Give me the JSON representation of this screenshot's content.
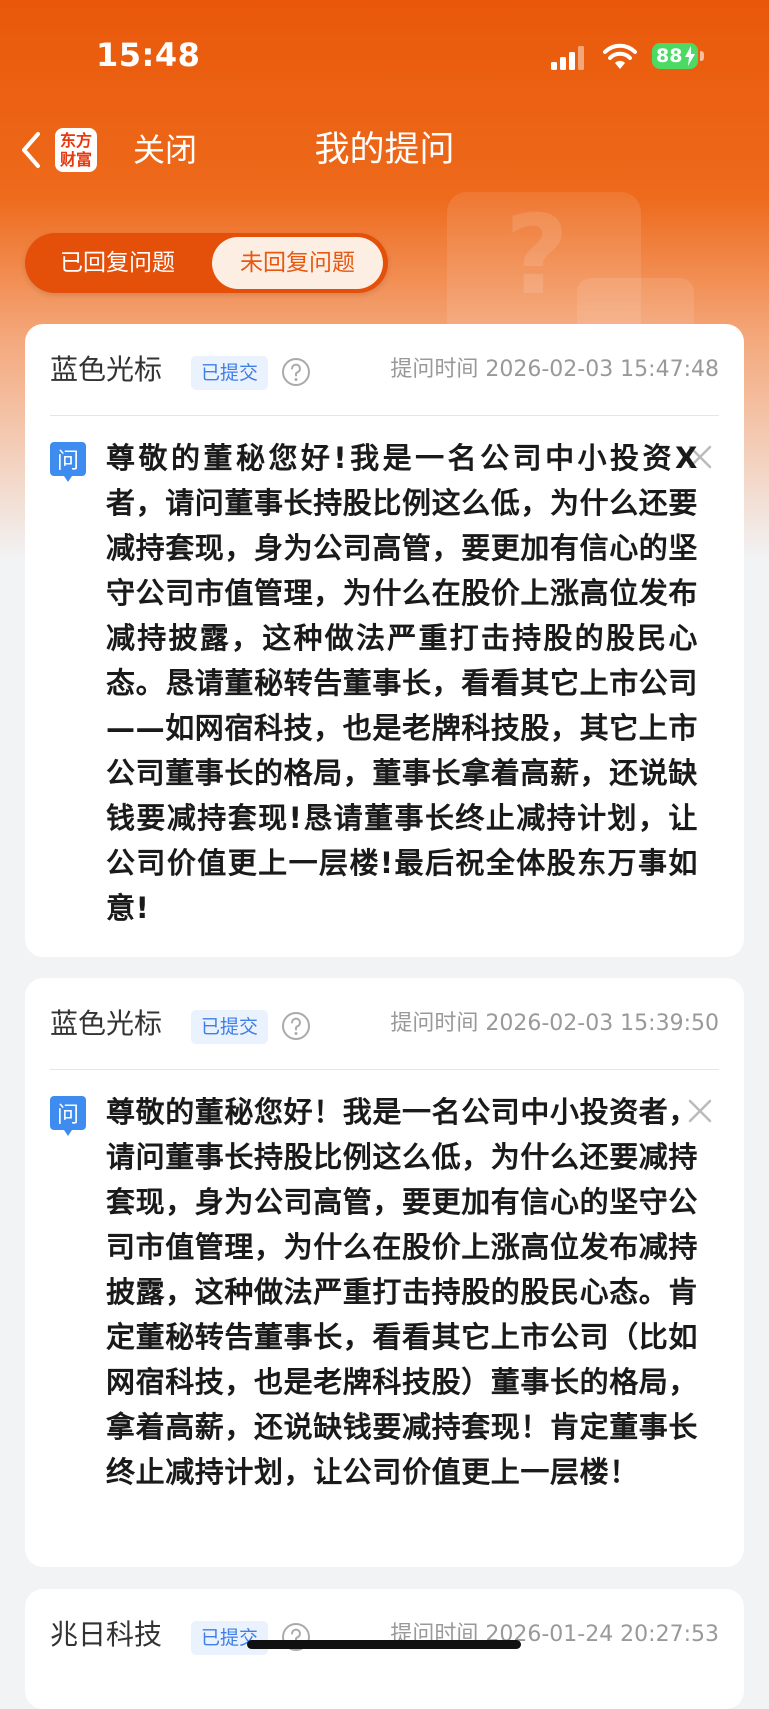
{
  "status_bar": {
    "time": "15:48",
    "battery": "88"
  },
  "nav": {
    "logo_line1": "东方",
    "logo_line2": "财富",
    "close_label": "关闭",
    "title": "我的提问"
  },
  "tabs": [
    {
      "label": "已回复问题",
      "active": false
    },
    {
      "label": "未回复问题",
      "active": true
    }
  ],
  "questions": [
    {
      "company": "蓝色光标",
      "status": "已提交",
      "time": "提问时间 2026-02-03 15:47:48",
      "text": "尊敬的董秘您好!我是一名公司中小投资X者，请问董事长持股比例这么低，为什么还要减持套现，身为公司高管，要更加有信心的坚守公司市值管理，为什么在股价上涨高位发布减持披露，这种做法严重打击持股的股民心态。恳请董秘转告董事长，看看其它上市公司——如网宿科技，也是老牌科技股，其它上市公司董事长的格局，董事长拿着高薪，还说缺钱要减持套现!恳请董事长终止减持计划，让公司价值更上一层楼!最后祝全体股东万事如意!"
    },
    {
      "company": "蓝色光标",
      "status": "已提交",
      "time": "提问时间 2026-02-03 15:39:50",
      "text": "尊敬的董秘您好！我是一名公司中小投资者，请问董事长持股比例这么低，为什么还要减持套现，身为公司高管，要更加有信心的坚守公司市值管理，为什么在股价上涨高位发布减持披露，这种做法严重打击持股的股民心态。肯定董秘转告董事长，看看其它上市公司（比如网宿科技，也是老牌科技股）董事长的格局，拿着高薪，还说缺钱要减持套现！肯定董事长终止减持计划，让公司价值更上一层楼！"
    },
    {
      "company": "兆日科技",
      "status": "已提交",
      "time": "提问时间 2026-01-24 20:27:53",
      "text": ""
    }
  ],
  "colors": {
    "brand_orange": "#e9580a",
    "badge_blue": "#3e7ee8",
    "battery_green": "#4cd964"
  }
}
